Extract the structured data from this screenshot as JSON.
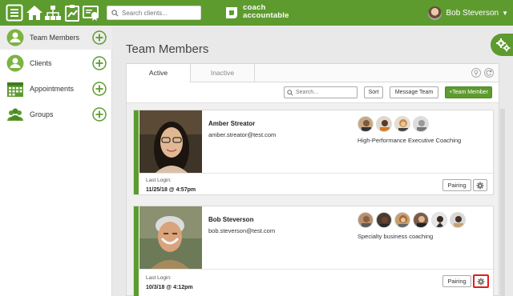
{
  "topbar": {
    "search_placeholder": "Search clients...",
    "logo_line1": "coach",
    "logo_line2": "accountable",
    "user_name": "Bob Steverson",
    "user_caret": "▼",
    "icons": [
      "menu-icon",
      "home-icon",
      "org-chart-icon",
      "clipboard-chart-icon",
      "certificate-icon"
    ],
    "brand_color": "#5d9b2f"
  },
  "sidebar": {
    "items": [
      {
        "label": "Team Members",
        "icon": "team-member-icon",
        "active": true
      },
      {
        "label": "Clients",
        "icon": "client-icon",
        "active": false
      },
      {
        "label": "Appointments",
        "icon": "calendar-icon",
        "active": false
      },
      {
        "label": "Groups",
        "icon": "group-icon",
        "active": false
      }
    ]
  },
  "main": {
    "title": "Team Members",
    "tabs": [
      {
        "label": "Active",
        "active": true
      },
      {
        "label": "Inactive",
        "active": false
      }
    ],
    "toolbar": {
      "search_placeholder": "Search...",
      "sort_label": "Sort",
      "message_label": "Message Team",
      "add_label": "+Team Member"
    },
    "members": [
      {
        "name": "Amber Streator",
        "email": "amber.streator@test.com",
        "program": "High-Performance Executive Coaching",
        "last_login_label": "Last Login:",
        "last_login": "11/25/18 @ 4:57pm",
        "pairing_label": "Pairing",
        "client_count": 4
      },
      {
        "name": "Bob Steverson",
        "email": "bob.steverson@test.com",
        "program": "Specialty business coaching",
        "last_login_label": "Last Login:",
        "last_login": "10/3/18 @ 4:12pm",
        "pairing_label": "Pairing",
        "client_count": 6
      }
    ],
    "highlight_color": "#e21c1c"
  }
}
